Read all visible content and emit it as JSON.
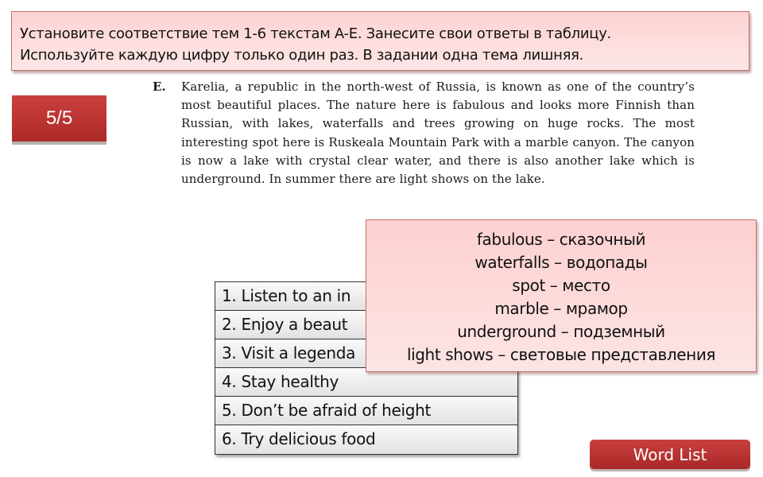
{
  "instruction": {
    "lines": [
      "Установите соответствие тем 1-6 текстам A-E. Занесите свои ответы в таблицу.",
      "Используйте каждую цифру только один раз. В задании одна тема лишняя."
    ]
  },
  "progress_badge": {
    "label": "5/5",
    "current": 5,
    "total": 5
  },
  "passage": {
    "label": "E.",
    "text": "Karelia, a republic in  the north-west of Russia, is known as one of the country’s most beautiful places. The nature here is fabulous and looks more Finnish than Russian, with lakes, waterfalls and trees growing on huge rocks. The most interesting spot here is Ruskeala Mountain Park with a marble canyon. The canyon is now a lake with crystal clear water, and there is also another lake which is underground. In summer there are light shows on the lake."
  },
  "topics": [
    "1. Listen to an in",
    "2. Enjoy a beaut",
    "3. Visit a legenda",
    "4. Stay healthy",
    "5. Don’t be afraid of height",
    "6. Try delicious food"
  ],
  "word_list": {
    "entries": [
      "fabulous – сказочный",
      "waterfalls – водопады",
      "spot – место",
      "marble – мрамор",
      "underground – подземный",
      "light shows – световые представления"
    ]
  },
  "buttons": {
    "word_list_label": "Word List"
  },
  "colors": {
    "accent_red": "#b8302f",
    "pink_panel": "#fdd3d3",
    "panel_border": "#c46f6f"
  }
}
